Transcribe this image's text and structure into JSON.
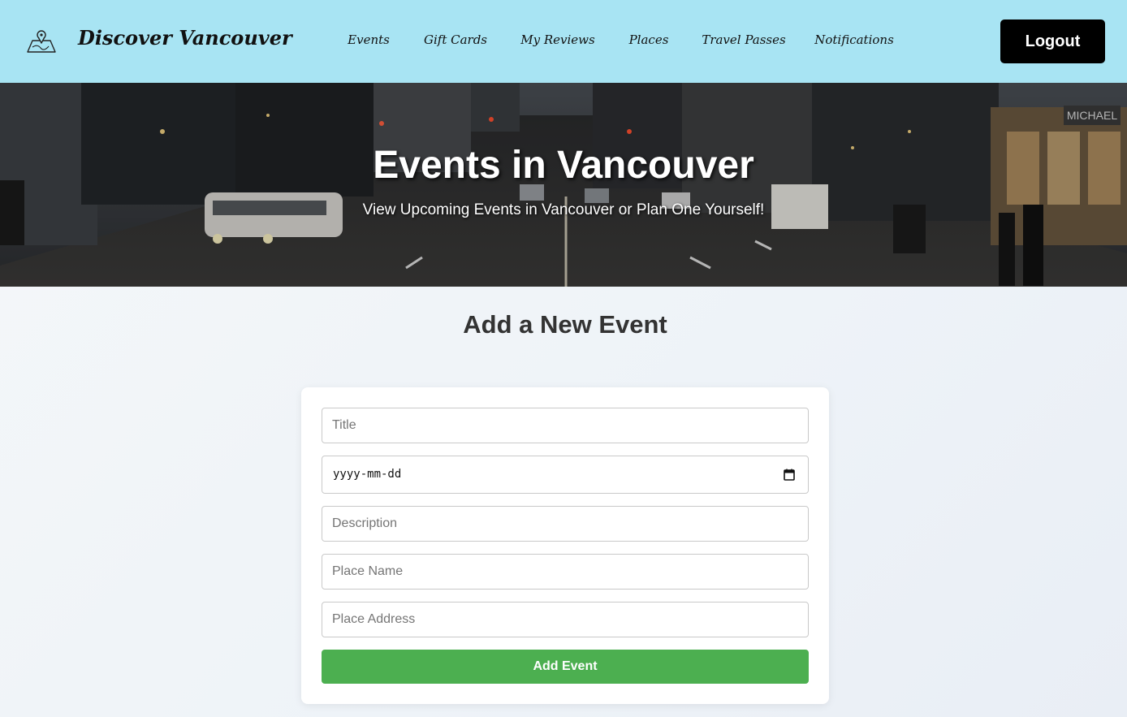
{
  "navbar": {
    "brand": "Discover Vancouver",
    "brand_icon": "map-pin-icon",
    "links": [
      "Events",
      "Gift Cards",
      "My Reviews",
      "Places",
      "Travel Passes",
      "Notifications"
    ],
    "logout_label": "Logout"
  },
  "hero": {
    "title": "Events in Vancouver",
    "subtitle": "View Upcoming Events in Vancouver or Plan One Yourself!",
    "storefront_sign": "MICHAEL"
  },
  "form": {
    "heading": "Add a New Event",
    "title_placeholder": "Title",
    "date_value": "yyyy-mm-dd",
    "date_icon": "calendar-icon",
    "description_placeholder": "Description",
    "place_name_placeholder": "Place Name",
    "place_address_placeholder": "Place Address",
    "submit_label": "Add Event"
  },
  "colors": {
    "navbar_bg": "#a8e4f3",
    "logout_bg": "#000000",
    "submit_bg": "#4caf50",
    "heading_text": "#333333"
  }
}
